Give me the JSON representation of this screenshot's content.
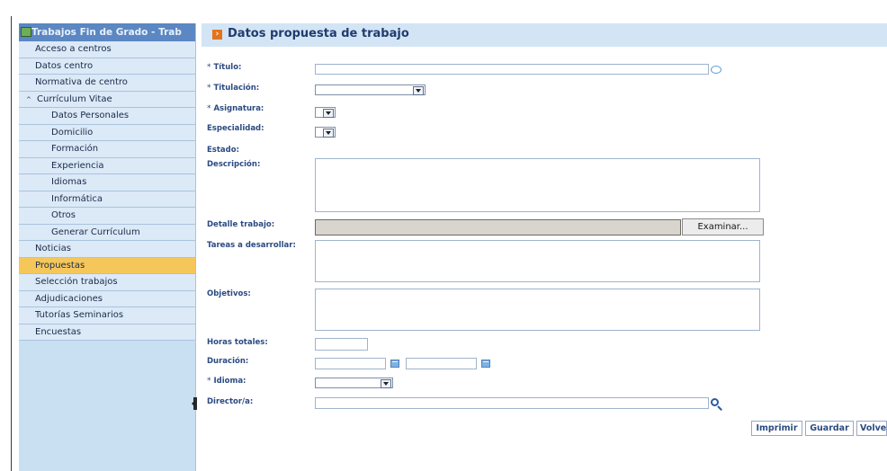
{
  "sidebar": {
    "header": "Trabajos Fin de Grado - Trab",
    "items": [
      {
        "label": "Acceso a centros",
        "level": 0
      },
      {
        "label": "Datos centro",
        "level": 0
      },
      {
        "label": "Normativa de centro",
        "level": 0
      },
      {
        "label": "Currículum Vitae",
        "level": 0,
        "expand": "^"
      },
      {
        "label": "Datos Personales",
        "level": 1
      },
      {
        "label": "Domicilio",
        "level": 1
      },
      {
        "label": "Formación",
        "level": 1
      },
      {
        "label": "Experiencia",
        "level": 1
      },
      {
        "label": "Idiomas",
        "level": 1
      },
      {
        "label": "Informática",
        "level": 1
      },
      {
        "label": "Otros",
        "level": 1
      },
      {
        "label": "Generar Currículum",
        "level": 1
      },
      {
        "label": "Noticias",
        "level": 0
      },
      {
        "label": "Propuestas",
        "level": 0,
        "active": true
      },
      {
        "label": "Selección trabajos",
        "level": 0
      },
      {
        "label": "Adjudicaciones",
        "level": 0
      },
      {
        "label": "Tutorías Seminarios",
        "level": 0
      },
      {
        "label": "Encuestas",
        "level": 0
      }
    ]
  },
  "main": {
    "title": "Datos propuesta de trabajo",
    "title_icon": "arrow-icon",
    "required_mark": "*",
    "fields": {
      "titulo": {
        "label": "Título:",
        "value": ""
      },
      "titulacion": {
        "label": "Titulación:",
        "value": ""
      },
      "asignatura": {
        "label": "Asignatura:",
        "value": ""
      },
      "especialidad": {
        "label": "Especialidad:",
        "value": ""
      },
      "estado": {
        "label": "Estado:",
        "value": ""
      },
      "descripcion": {
        "label": "Descripción:",
        "value": ""
      },
      "detalle": {
        "label": "Detalle trabajo:",
        "button": "Examinar..."
      },
      "tareas": {
        "label": "Tareas a desarrollar:",
        "value": ""
      },
      "objetivos": {
        "label": "Objetivos:",
        "value": ""
      },
      "horas": {
        "label": "Horas totales:",
        "value": ""
      },
      "duracion": {
        "label": "Duración:",
        "from": "",
        "to": ""
      },
      "idioma": {
        "label": "Idioma:",
        "value": ""
      },
      "director": {
        "label": "Director/a:",
        "value": ""
      }
    },
    "buttons": {
      "imprimir": "Imprimir",
      "guardar": "Guardar",
      "volver": "Volve"
    }
  },
  "colors": {
    "sidebar_bg": "#c9dff2",
    "header_bg": "#5b87c2",
    "active_item": "#f5c75a",
    "title_bar": "#d3e5f5",
    "label": "#2b4a82"
  }
}
